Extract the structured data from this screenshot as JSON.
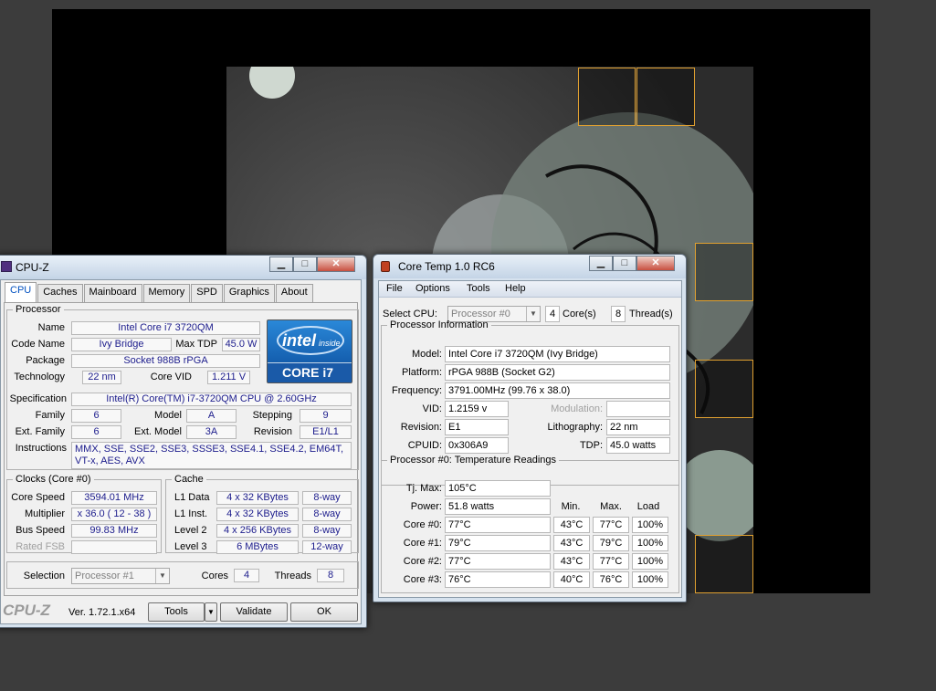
{
  "cpuz": {
    "title": "CPU-Z",
    "tabs": [
      "CPU",
      "Caches",
      "Mainboard",
      "Memory",
      "SPD",
      "Graphics",
      "About"
    ],
    "processor_legend": "Processor",
    "labels": {
      "name": "Name",
      "code_name": "Code Name",
      "max_tdp": "Max TDP",
      "package": "Package",
      "technology": "Technology",
      "core_vid": "Core VID",
      "specification": "Specification",
      "family": "Family",
      "model": "Model",
      "stepping": "Stepping",
      "ext_family": "Ext. Family",
      "ext_model": "Ext. Model",
      "revision": "Revision",
      "instructions": "Instructions"
    },
    "values": {
      "name": "Intel Core i7 3720QM",
      "code_name": "Ivy Bridge",
      "max_tdp": "45.0 W",
      "package": "Socket 988B rPGA",
      "technology": "22 nm",
      "core_vid": "1.211 V",
      "specification": "Intel(R) Core(TM) i7-3720QM CPU @ 2.60GHz",
      "family": "6",
      "model": "A",
      "stepping": "9",
      "ext_family": "6",
      "ext_model": "3A",
      "revision": "E1/L1",
      "instructions": "MMX, SSE, SSE2, SSE3, SSSE3, SSE4.1, SSE4.2, EM64T, VT-x, AES, AVX"
    },
    "logo": {
      "brand": "intel",
      "badge": "inside",
      "product": "CORE i7",
      "color": "#0068b5"
    },
    "clocks": {
      "legend": "Clocks (Core #0)",
      "labels": [
        "Core Speed",
        "Multiplier",
        "Bus Speed",
        "Rated FSB"
      ],
      "values": [
        "3594.01 MHz",
        "x 36.0 ( 12 - 38 )",
        "99.83 MHz",
        ""
      ]
    },
    "cache": {
      "legend": "Cache",
      "rows": [
        {
          "label": "L1 Data",
          "size": "4 x 32 KBytes",
          "way": "8-way"
        },
        {
          "label": "L1 Inst.",
          "size": "4 x 32 KBytes",
          "way": "8-way"
        },
        {
          "label": "Level 2",
          "size": "4 x 256 KBytes",
          "way": "8-way"
        },
        {
          "label": "Level 3",
          "size": "6 MBytes",
          "way": "12-way"
        }
      ]
    },
    "selection_label": "Selection",
    "selection_value": "Processor #1",
    "cores_label": "Cores",
    "cores_value": "4",
    "threads_label": "Threads",
    "threads_value": "8",
    "footer": {
      "brand": "CPU-Z",
      "version": "Ver. 1.72.1.x64",
      "tools": "Tools",
      "validate": "Validate",
      "ok": "OK"
    }
  },
  "coretemp": {
    "title": "Core Temp 1.0 RC6",
    "menu": [
      "File",
      "Options",
      "Tools",
      "Help"
    ],
    "select_cpu_label": "Select CPU:",
    "select_cpu_value": "Processor #0",
    "cores_value": "4",
    "cores_label": "Core(s)",
    "threads_value": "8",
    "threads_label": "Thread(s)",
    "info_legend": "Processor Information",
    "info": {
      "model_label": "Model:",
      "model": "Intel Core i7 3720QM (Ivy Bridge)",
      "platform_label": "Platform:",
      "platform": "rPGA 988B (Socket G2)",
      "frequency_label": "Frequency:",
      "frequency": "3791.00MHz (99.76 x 38.0)",
      "vid_label": "VID:",
      "vid": "1.2159 v",
      "modulation_label": "Modulation:",
      "modulation": "",
      "revision_label": "Revision:",
      "revision": "E1",
      "lithography_label": "Lithography:",
      "lithography": "22 nm",
      "cpuid_label": "CPUID:",
      "cpuid": "0x306A9",
      "tdp_label": "TDP:",
      "tdp": "45.0 watts"
    },
    "temps_legend": "Processor #0: Temperature Readings",
    "tjmax_label": "Tj. Max:",
    "tjmax": "105°C",
    "power_label": "Power:",
    "power": "51.8 watts",
    "col_headers": [
      "Min.",
      "Max.",
      "Load"
    ],
    "cores": [
      {
        "label": "Core #0:",
        "temp": "77°C",
        "min": "43°C",
        "max": "77°C",
        "load": "100%"
      },
      {
        "label": "Core #1:",
        "temp": "79°C",
        "min": "43°C",
        "max": "79°C",
        "load": "100%"
      },
      {
        "label": "Core #2:",
        "temp": "77°C",
        "min": "43°C",
        "max": "77°C",
        "load": "100%"
      },
      {
        "label": "Core #3:",
        "temp": "76°C",
        "min": "40°C",
        "max": "76°C",
        "load": "100%"
      }
    ]
  }
}
